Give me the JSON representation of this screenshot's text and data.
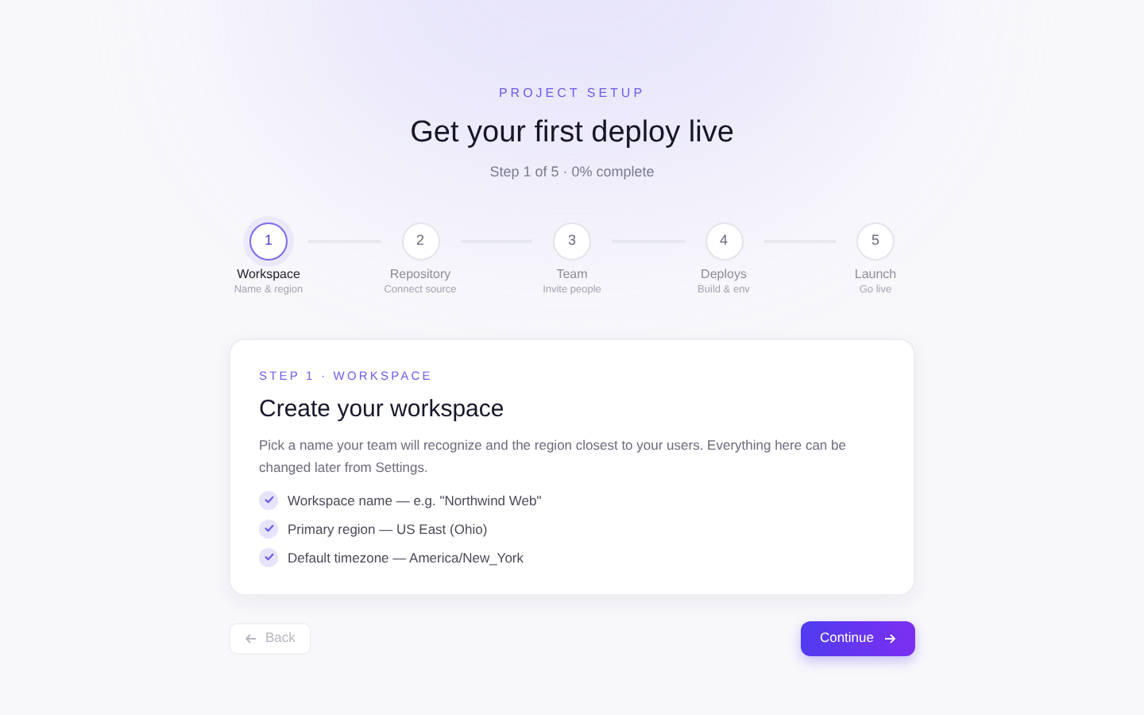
{
  "header": {
    "eyebrow": "PROJECT SETUP",
    "title": "Get your first deploy live",
    "subtitle": "Step 1 of 5 · 0% complete"
  },
  "steps": [
    {
      "number": "1",
      "label": "Workspace",
      "caption": "Name & region",
      "selected": true
    },
    {
      "number": "2",
      "label": "Repository",
      "caption": "Connect source",
      "selected": false
    },
    {
      "number": "3",
      "label": "Team",
      "caption": "Invite people",
      "selected": false
    },
    {
      "number": "4",
      "label": "Deploys",
      "caption": "Build & env",
      "selected": false
    },
    {
      "number": "5",
      "label": "Launch",
      "caption": "Go live",
      "selected": false
    }
  ],
  "card": {
    "eyebrow": "STEP 1 · WORKSPACE",
    "title": "Create your workspace",
    "description": "Pick a name your team will recognize and the region closest to your users. Everything here can be changed later from Settings.",
    "items": [
      {
        "text": "Workspace name — e.g. \"Northwind Web\"",
        "checked": true
      },
      {
        "text": "Primary region — US East (Ohio)",
        "checked": true
      },
      {
        "text": "Default timezone — America/New_York",
        "checked": true
      }
    ]
  },
  "footer": {
    "back": {
      "label": "Back",
      "disabled": true
    },
    "continue": {
      "label": "Continue"
    }
  }
}
